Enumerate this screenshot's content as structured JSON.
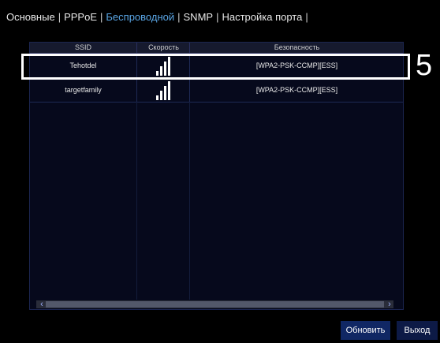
{
  "tabs": [
    {
      "label": "Основные"
    },
    {
      "label": "PPPoE"
    },
    {
      "label": "Беспроводной"
    },
    {
      "label": "SNMP"
    },
    {
      "label": "Настройка порта"
    }
  ],
  "separator": "|",
  "active_tab_index": 2,
  "table": {
    "headers": {
      "ssid": "SSID",
      "speed": "Скорость",
      "security": "Безопасность"
    },
    "rows": [
      {
        "ssid": "Tehotdel",
        "security": "[WPA2-PSK-CCMP][ESS]",
        "signal_level": 4
      },
      {
        "ssid": "targetfamily",
        "security": "[WPA2-PSK-CCMP][ESS]",
        "signal_level": 4
      }
    ],
    "signal_max": 4
  },
  "callout": {
    "label": "5"
  },
  "buttons": {
    "refresh": "Обновить",
    "exit": "Выход"
  },
  "colors": {
    "active_tab": "#5aa6e6",
    "background": "#000000",
    "button": "#102764"
  }
}
